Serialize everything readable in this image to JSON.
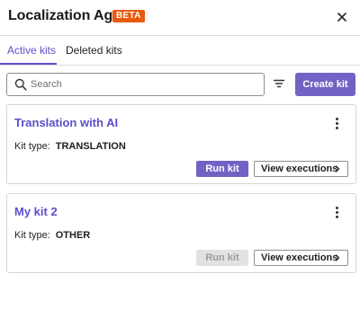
{
  "header": {
    "title": "Localization Agent",
    "badge": "BETA",
    "badge_color": "#e8590c",
    "close_icon": "close-icon"
  },
  "tabs": [
    {
      "label": "Active kits",
      "active": true
    },
    {
      "label": "Deleted kits",
      "active": false
    }
  ],
  "accent_color": "#5c4fc9",
  "toolbar": {
    "search_placeholder": "Search",
    "search_value": "",
    "filter_icon": "filter-icon",
    "create_label": "Create kit"
  },
  "kits": [
    {
      "name": "Translation with AI",
      "type_label": "Kit type:",
      "type_value": "TRANSLATION",
      "run_label": "Run kit",
      "run_enabled": true,
      "view_label": "View executions"
    },
    {
      "name": "My kit 2",
      "type_label": "Kit type:",
      "type_value": "OTHER",
      "run_label": "Run kit",
      "run_enabled": false,
      "view_label": "View executions"
    }
  ]
}
